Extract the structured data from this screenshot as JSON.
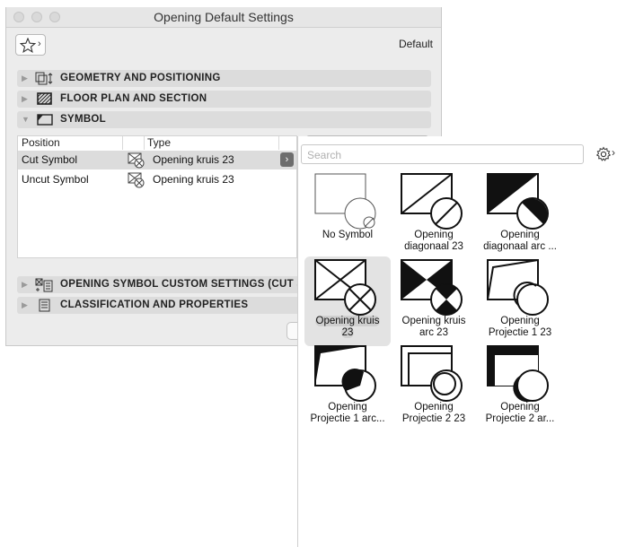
{
  "window": {
    "title": "Opening Default Settings",
    "default_label": "Default"
  },
  "sections": {
    "geometry": "GEOMETRY AND POSITIONING",
    "floor_plan": "FLOOR PLAN AND SECTION",
    "symbol": "SYMBOL",
    "custom": "OPENING SYMBOL CUSTOM SETTINGS (CUT S",
    "classification": "CLASSIFICATION AND PROPERTIES"
  },
  "table": {
    "headers": [
      "Position",
      "Type"
    ],
    "rows": [
      {
        "position": "Cut Symbol",
        "type": "Opening kruis 23",
        "selected": true
      },
      {
        "position": "Uncut Symbol",
        "type": "Opening kruis 23",
        "selected": false
      }
    ]
  },
  "popover": {
    "search_placeholder": "Search",
    "items": [
      {
        "line1": "No Symbol",
        "line2": "",
        "icon": "no-symbol-icon",
        "selected": false
      },
      {
        "line1": "Opening",
        "line2": "diagonaal 23",
        "icon": "diagonal-icon",
        "selected": false
      },
      {
        "line1": "Opening",
        "line2": "diagonaal arc ...",
        "icon": "diagonal-arc-icon",
        "selected": false
      },
      {
        "line1": "Opening kruis",
        "line2": "23",
        "icon": "cross-icon",
        "selected": true
      },
      {
        "line1": "Opening kruis",
        "line2": "arc 23",
        "icon": "cross-arc-icon",
        "selected": false
      },
      {
        "line1": "Opening",
        "line2": "Projectie 1 23",
        "icon": "projection-1-icon",
        "selected": false
      },
      {
        "line1": "Opening",
        "line2": "Projectie 1 arc...",
        "icon": "projection-1-arc-icon",
        "selected": false
      },
      {
        "line1": "Opening",
        "line2": "Projectie 2 23",
        "icon": "projection-2-icon",
        "selected": false
      },
      {
        "line1": "Opening",
        "line2": "Projectie 2 ar...",
        "icon": "projection-2-arc-icon",
        "selected": false
      }
    ]
  }
}
